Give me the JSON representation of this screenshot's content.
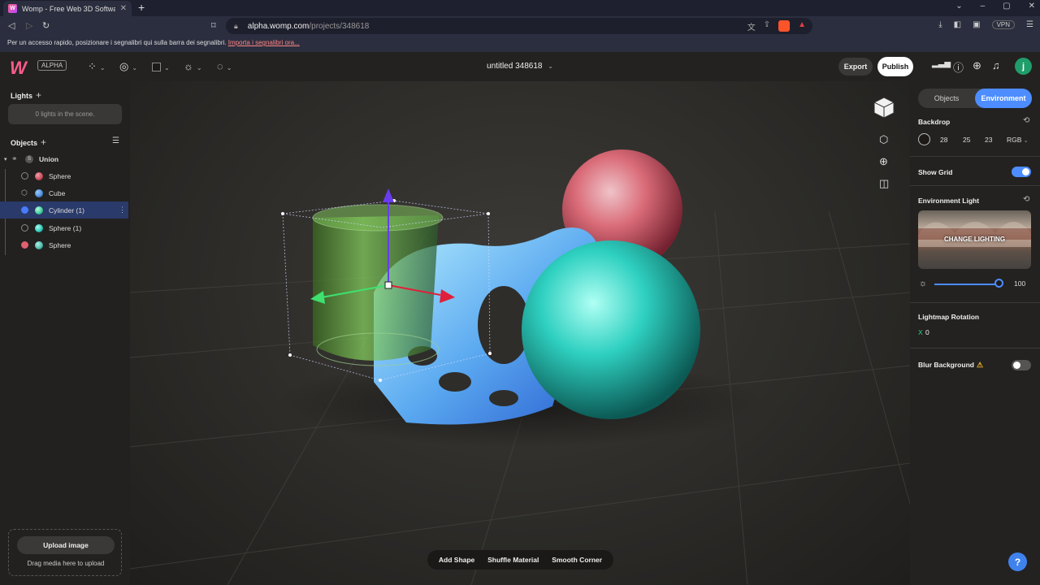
{
  "browser": {
    "tab_title": "Womp - Free Web 3D Software",
    "tab_close": "✕",
    "new_tab": "+",
    "url_domain": "alpha.womp.com",
    "url_path": "/projects/348618",
    "vpn": "VPN",
    "bookmark_hint": "Per un accesso rapido, posizionare i segnalibri qui sulla barra dei segnalibri.",
    "bookmark_link": "Importa i segnalibri ora..."
  },
  "app": {
    "logo_text": "W",
    "alpha_badge": "ALPHA",
    "project_title": "untitled 348618",
    "export_label": "Export",
    "publish_label": "Publish",
    "avatar_initial": "j"
  },
  "left_panel": {
    "lights_title": "Lights",
    "lights_empty": "0 lights in the scene.",
    "objects_title": "Objects",
    "tree": {
      "root": {
        "label": "Union",
        "badge": "S"
      },
      "children": [
        {
          "label": "Sphere",
          "color": "#c94a5a",
          "selected": false
        },
        {
          "label": "Cube",
          "color": "#4a8fd8",
          "selected": false
        },
        {
          "label": "Cylinder (1)",
          "color": "#3ec99a",
          "selected": true
        },
        {
          "label": "Sphere (1)",
          "color": "#2ec4b6",
          "selected": false
        },
        {
          "label": "Sphere",
          "color": "#4ab8a8",
          "selected": false
        }
      ]
    },
    "upload_button": "Upload image",
    "upload_hint": "Drag media here to upload"
  },
  "viewport": {
    "bottom_tools": [
      "Add Shape",
      "Shuffle Material",
      "Smooth Corner"
    ]
  },
  "right_panel": {
    "tabs": {
      "objects": "Objects",
      "environment": "Environment"
    },
    "backdrop": {
      "title": "Backdrop",
      "r": "28",
      "g": "25",
      "b": "23",
      "mode": "RGB"
    },
    "show_grid": {
      "label": "Show Grid",
      "on": true
    },
    "environment_light": {
      "title": "Environment Light",
      "button_label": "CHANGE LIGHTING",
      "intensity": "100"
    },
    "lightmap_rotation": {
      "title": "Lightmap Rotation",
      "axis": "X",
      "value": "0"
    },
    "blur_background": {
      "label": "Blur Background",
      "on": false
    },
    "help": "?"
  },
  "colors": {
    "accent": "#4d8dff",
    "brand": "#ff5c8a",
    "toggle_off": "#555453",
    "green_axis": "#29d27e"
  }
}
